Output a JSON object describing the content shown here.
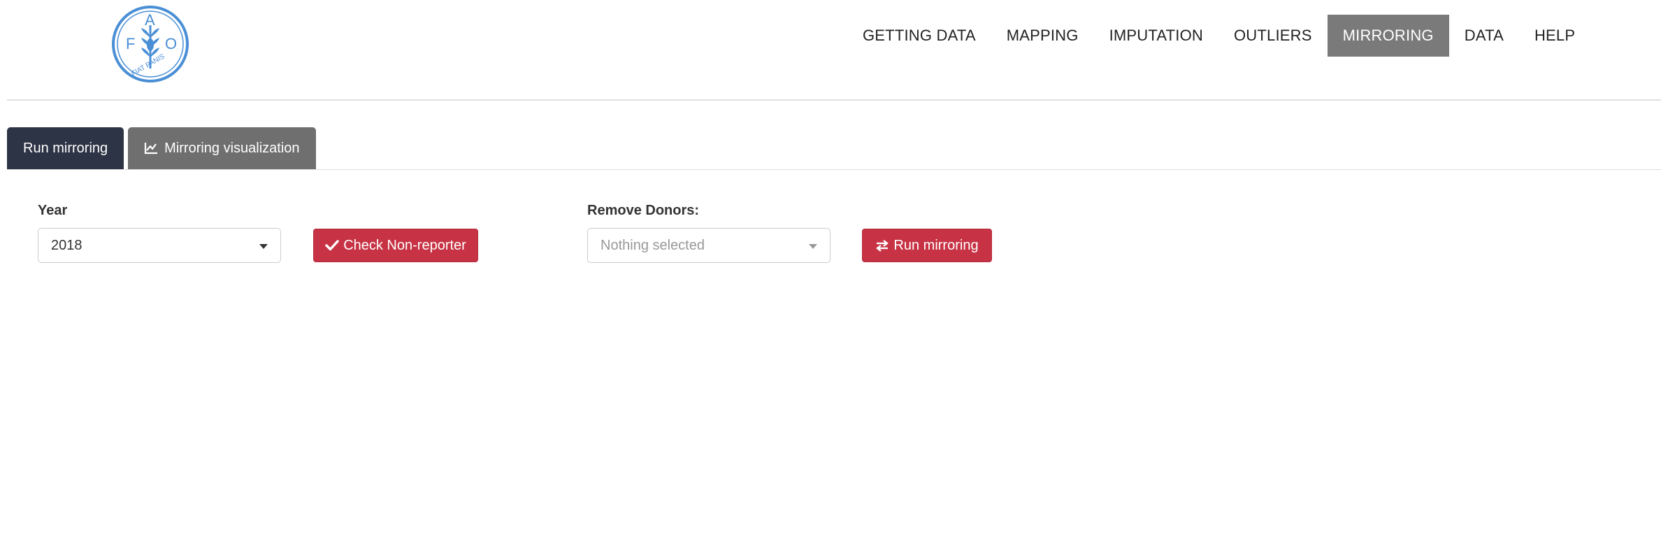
{
  "logo": {
    "letters": [
      "F",
      "A",
      "O"
    ],
    "motto": "FIAT PANIS",
    "color": "#4a8fd6"
  },
  "nav": {
    "items": [
      {
        "label": "GETTING DATA"
      },
      {
        "label": "MAPPING"
      },
      {
        "label": "IMPUTATION"
      },
      {
        "label": "OUTLIERS"
      },
      {
        "label": "MIRRORING",
        "active": true
      },
      {
        "label": "DATA"
      },
      {
        "label": "HELP"
      }
    ]
  },
  "tabs": [
    {
      "label": "Run mirroring",
      "active": true
    },
    {
      "label": "Mirroring visualization",
      "icon": "line-chart-icon"
    }
  ],
  "controls": {
    "year_label": "Year",
    "year_value": "2018",
    "check_button": "Check Non-reporter",
    "check_icon": "check-icon",
    "donors_label": "Remove Donors:",
    "donors_placeholder": "Nothing selected",
    "run_button": "Run mirroring",
    "run_icon": "exchange-icon"
  },
  "colors": {
    "active_nav": "#7a7a7a",
    "active_tab": "#2d3445",
    "inactive_tab": "#6f6f6f",
    "danger_button": "#c73345"
  }
}
